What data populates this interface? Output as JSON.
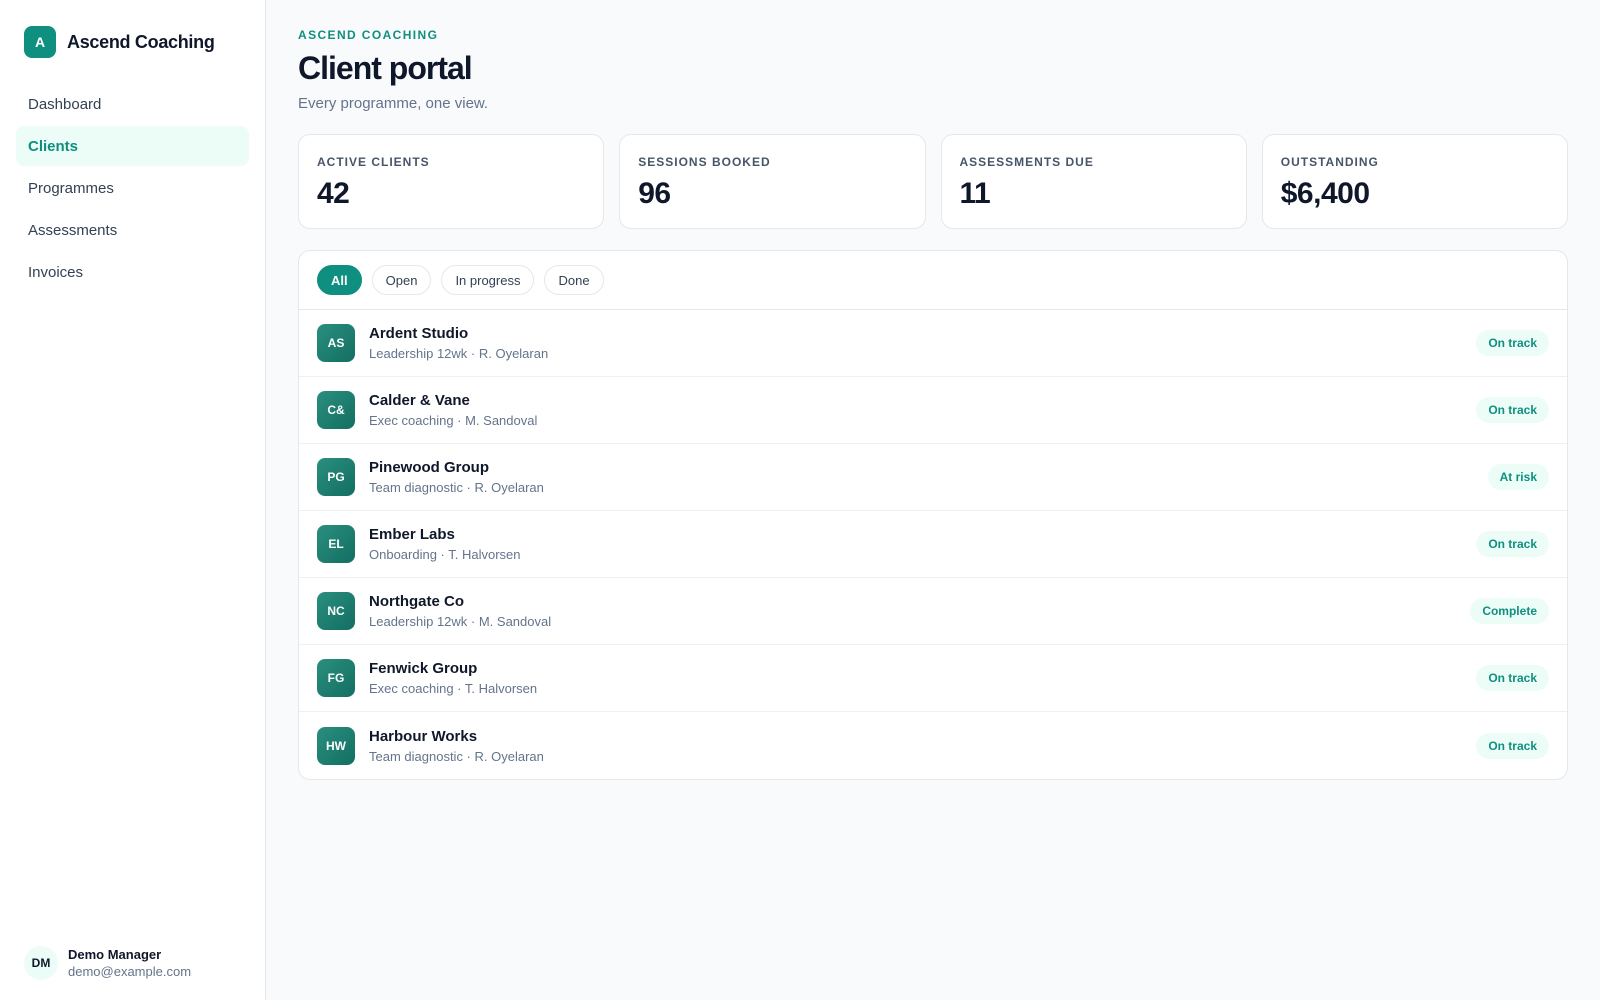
{
  "brand": {
    "logo_letter": "A",
    "name": "Ascend Coaching"
  },
  "nav": {
    "items": [
      {
        "label": "Dashboard"
      },
      {
        "label": "Clients",
        "active": true
      },
      {
        "label": "Programmes"
      },
      {
        "label": "Assessments"
      },
      {
        "label": "Invoices"
      }
    ]
  },
  "user": {
    "initials": "DM",
    "name": "Demo Manager",
    "email": "demo@example.com"
  },
  "header": {
    "eyebrow": "ASCEND COACHING",
    "title": "Client portal",
    "subtitle": "Every programme, one view."
  },
  "stats": [
    {
      "label": "ACTIVE CLIENTS",
      "value": "42"
    },
    {
      "label": "SESSIONS BOOKED",
      "value": "96"
    },
    {
      "label": "ASSESSMENTS DUE",
      "value": "11"
    },
    {
      "label": "OUTSTANDING",
      "value": "$6,400"
    }
  ],
  "filters": [
    {
      "label": "All",
      "active": true
    },
    {
      "label": "Open"
    },
    {
      "label": "In progress"
    },
    {
      "label": "Done"
    }
  ],
  "clients": [
    {
      "initials": "AS",
      "name": "Ardent Studio",
      "meta": "Leadership 12wk · R. Oyelaran",
      "status": "On track"
    },
    {
      "initials": "C&",
      "name": "Calder & Vane",
      "meta": "Exec coaching · M. Sandoval",
      "status": "On track"
    },
    {
      "initials": "PG",
      "name": "Pinewood Group",
      "meta": "Team diagnostic · R. Oyelaran",
      "status": "At risk"
    },
    {
      "initials": "EL",
      "name": "Ember Labs",
      "meta": "Onboarding · T. Halvorsen",
      "status": "On track"
    },
    {
      "initials": "NC",
      "name": "Northgate Co",
      "meta": "Leadership 12wk · M. Sandoval",
      "status": "Complete"
    },
    {
      "initials": "FG",
      "name": "Fenwick Group",
      "meta": "Exec coaching · T. Halvorsen",
      "status": "On track"
    },
    {
      "initials": "HW",
      "name": "Harbour Works",
      "meta": "Team diagnostic · R. Oyelaran",
      "status": "On track"
    }
  ],
  "colors": {
    "accent": "#0f8f7f",
    "accent_soft": "#ecfdf8"
  }
}
